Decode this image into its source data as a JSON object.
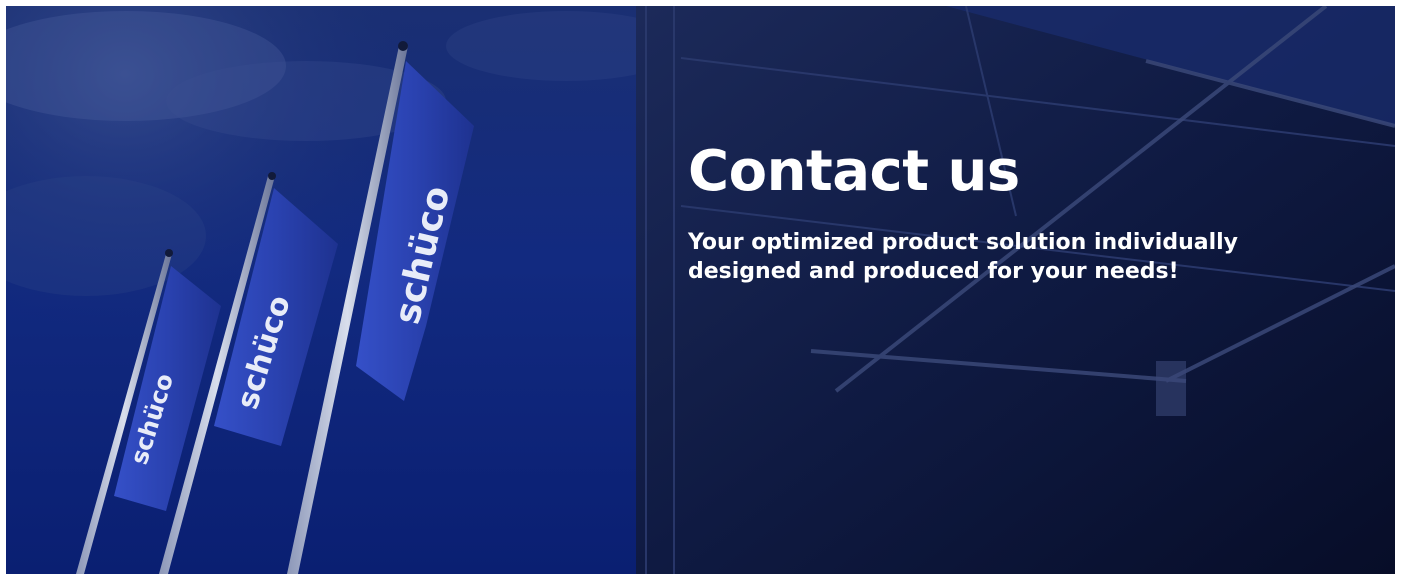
{
  "hero": {
    "title": "Contact us",
    "subtitle": "Your optimized product solution individually designed and produced for your needs!",
    "flag_wordmark": "schüco",
    "colors": {
      "sky_dark": "#061038",
      "sky_mid": "#14307a",
      "flag_blue": "#2a44b8",
      "building_dark": "#0a1230",
      "text": "#ffffff"
    }
  }
}
